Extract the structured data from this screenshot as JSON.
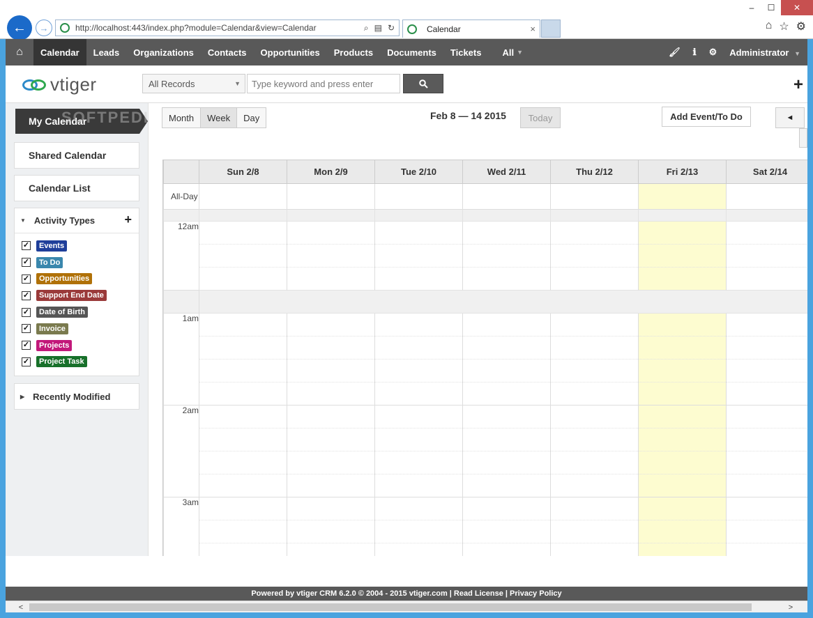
{
  "browser": {
    "url": "http://localhost:443/index.php?module=Calendar&view=Calendar",
    "tab_title": "Calendar",
    "tab_close": "×",
    "back_glyph": "←",
    "forward_glyph": "→",
    "minimize": "–",
    "maximize": "☐",
    "close": "✕",
    "home_glyph": "⌂",
    "favorites_glyph": "☆",
    "tools_glyph": "⚙"
  },
  "topnav": {
    "home_glyph": "⌂",
    "items": [
      {
        "label": "Calendar",
        "active": true
      },
      {
        "label": "Leads"
      },
      {
        "label": "Organizations"
      },
      {
        "label": "Contacts"
      },
      {
        "label": "Opportunities"
      },
      {
        "label": "Products"
      },
      {
        "label": "Documents"
      },
      {
        "label": "Tickets"
      },
      {
        "label": "All"
      }
    ],
    "brush_glyph": "🖌",
    "info_glyph": "ℹ",
    "settings_glyph": "⚙",
    "user": "Administrator"
  },
  "header": {
    "logo": "vtiger",
    "records_select": "All Records",
    "search_placeholder": "Type keyword and press enter",
    "search_glyph": "🔍",
    "quick_create": "+"
  },
  "sidebar": {
    "my_calendar": "My Calendar",
    "watermark": "SOFTPEDIA",
    "shared_calendar": "Shared Calendar",
    "calendar_list": "Calendar List",
    "activity_types": {
      "title": "Activity Types",
      "add": "+",
      "items": [
        {
          "label": "Events",
          "color": "#1f3f9a"
        },
        {
          "label": "To Do",
          "color": "#3a87ad"
        },
        {
          "label": "Opportunities",
          "color": "#b07108"
        },
        {
          "label": "Support End Date",
          "color": "#9a3a3a"
        },
        {
          "label": "Date of Birth",
          "color": "#555555"
        },
        {
          "label": "Invoice",
          "color": "#7a7a4e"
        },
        {
          "label": "Projects",
          "color": "#c2187a"
        },
        {
          "label": "Project Task",
          "color": "#17702a"
        }
      ]
    },
    "recently_modified": "Recently Modified"
  },
  "calendar": {
    "views": [
      "Month",
      "Week",
      "Day"
    ],
    "active_view": "Week",
    "date_range": "Feb 8 — 14 2015",
    "today": "Today",
    "add_event": "Add Event/To Do",
    "prev_glyph": "◄",
    "days": [
      "Sun 2/8",
      "Mon 2/9",
      "Tue 2/10",
      "Wed 2/11",
      "Thu 2/12",
      "Fri 2/13",
      "Sat 2/14"
    ],
    "highlight_day": "Fri 2/13",
    "all_day": "All-Day",
    "hours": [
      "12am",
      "1am",
      "2am",
      "3am"
    ]
  },
  "footer": {
    "text": "Powered by vtiger CRM 6.2.0  © 2004 - 2015  vtiger.com | Read License | Privacy Policy"
  },
  "scrollbar": {
    "left": "<",
    "right": ">"
  }
}
